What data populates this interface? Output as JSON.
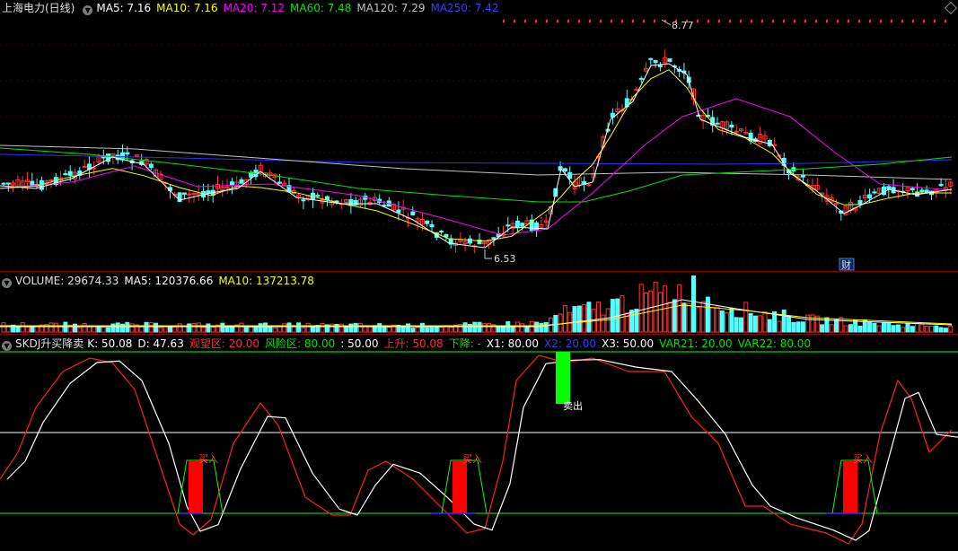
{
  "colors": {
    "up": "#ff3232",
    "down": "#54ffff",
    "ma5": "#ffffff",
    "ma10": "#ffff00",
    "ma20": "#ff00ff",
    "ma60": "#00e600",
    "ma120": "#c0c0c0",
    "ma250": "#3030ff",
    "k": "#ff2020",
    "d": "#ffffff",
    "zone": "#00ff00",
    "divider": "#8b0000",
    "buy": "#ff0000",
    "sell": "#00ff00",
    "x2": "#3030ff"
  },
  "price": {
    "title": "上海电力(日线)",
    "ma5_label": "MA5: 7.16",
    "ma10_label": "MA10: 7.16",
    "ma20_label": "MA20: 7.12",
    "ma60_label": "MA60: 7.48",
    "ma120_label": "MA120: 7.29",
    "ma250_label": "MA250: 7.42",
    "high_marker": "8.77",
    "low_marker": "6.53",
    "finance_badge": "财"
  },
  "volume": {
    "title": "VOLUME: 29674.33",
    "ma5_label": "MA5: 120376.66",
    "ma10_label": "MA10: 137213.78"
  },
  "skdj": {
    "title": "SKDJ升买降卖",
    "k_label": "K: 50.08",
    "d_label": "D: 47.63",
    "watch_label": "观望区: 20.00",
    "risk_label": "风险区: 80.00",
    "mid_label": ": 50.00",
    "rise_label": "上升: 50.08",
    "fall_label": "下降: -",
    "x1_label": "X1: 80.00",
    "x2_label": "X2: 20.00",
    "x3_label": "X3: 50.00",
    "var21_label": "VAR21: 20.00",
    "var22_label": "VAR22: 80.00",
    "buy_text": "买入",
    "sell_text": "卖出"
  }
}
